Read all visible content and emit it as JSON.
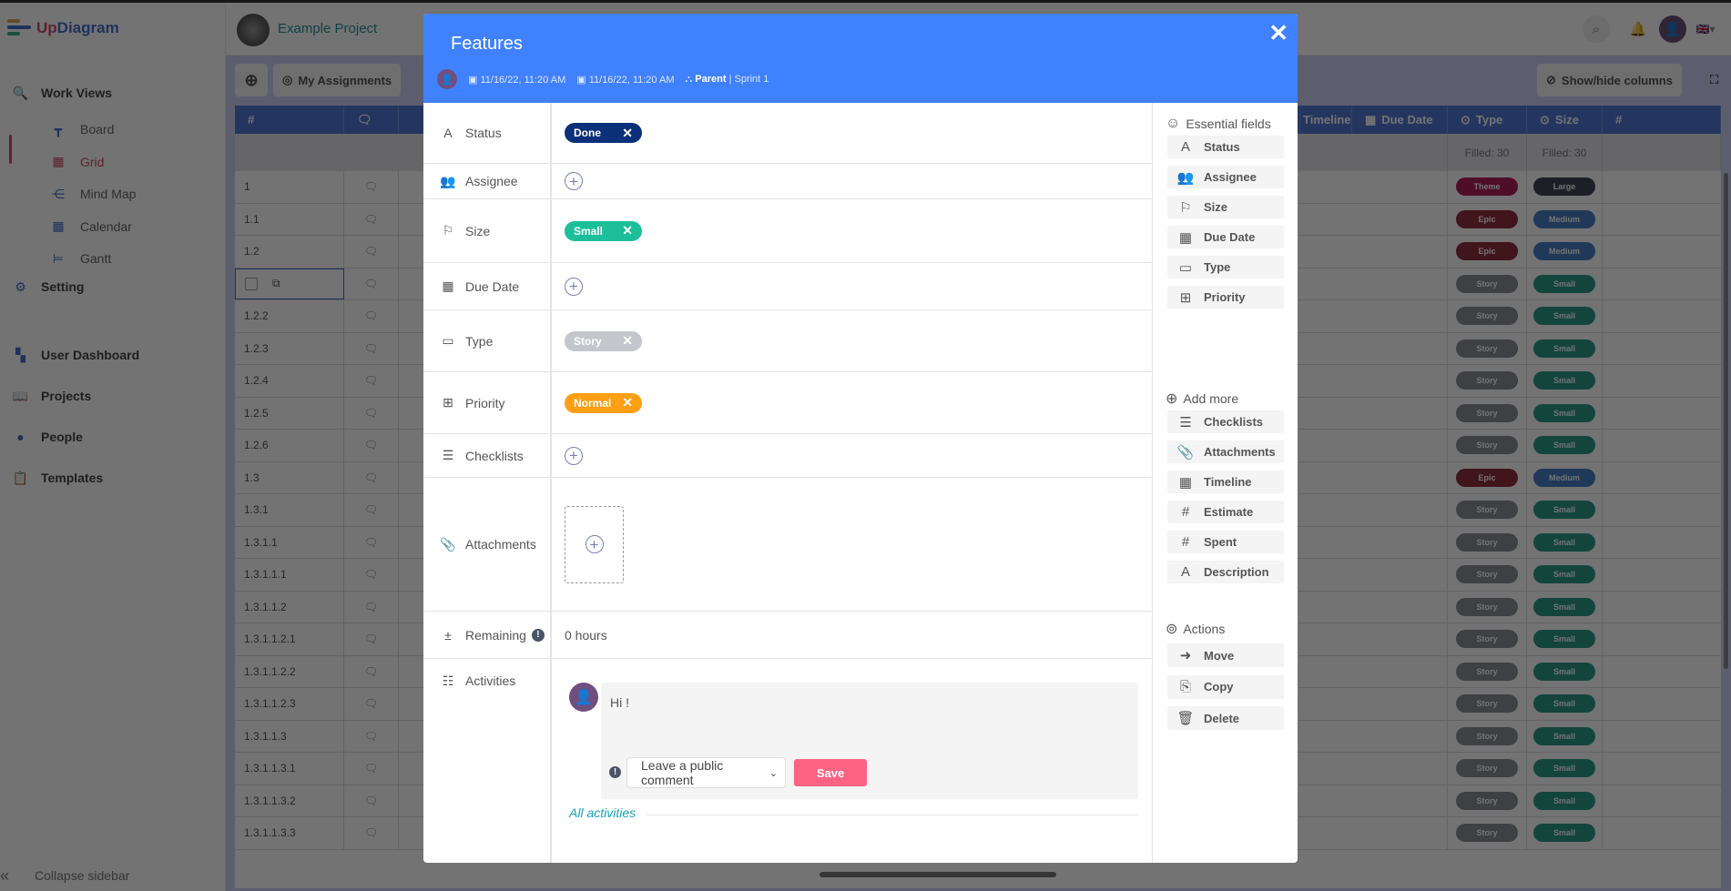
{
  "app": {
    "logo_text_a": "Up",
    "logo_text_b": "Diagram",
    "project_name": "Example Project"
  },
  "sidebar": {
    "work_views": "Work Views",
    "views": [
      {
        "label": "Board",
        "icon": "board-icon"
      },
      {
        "label": "Grid",
        "icon": "grid-icon",
        "active": true
      },
      {
        "label": "Mind Map",
        "icon": "mind-map-icon"
      },
      {
        "label": "Calendar",
        "icon": "calendar-icon"
      },
      {
        "label": "Gantt",
        "icon": "gantt-icon"
      }
    ],
    "setting": "Setting",
    "items": [
      {
        "label": "User Dashboard",
        "icon": "dashboard-icon"
      },
      {
        "label": "Projects",
        "icon": "book-icon"
      },
      {
        "label": "People",
        "icon": "person-icon"
      },
      {
        "label": "Templates",
        "icon": "clipboard-icon"
      }
    ],
    "collapse": "Collapse sidebar"
  },
  "toolbar": {
    "my_assignments": "My Assignments",
    "show_hide": "Show/hide columns"
  },
  "grid": {
    "headers": {
      "id": "#",
      "timeline": "Timeline",
      "due_date": "Due Date",
      "type": "Type",
      "size": "Size",
      "more": "#"
    },
    "filled_type": "Filled: 30",
    "filled_size": "Filled: 30",
    "rows": [
      {
        "id": "1",
        "type": "Theme",
        "size": "Large"
      },
      {
        "id": "1.1",
        "type": "Epic",
        "size": "Medium"
      },
      {
        "id": "1.2",
        "type": "Epic",
        "size": "Medium"
      },
      {
        "id": "",
        "type": "Story",
        "size": "Small",
        "selected": true
      },
      {
        "id": "1.2.2",
        "type": "Story",
        "size": "Small"
      },
      {
        "id": "1.2.3",
        "type": "Story",
        "size": "Small"
      },
      {
        "id": "1.2.4",
        "type": "Story",
        "size": "Small"
      },
      {
        "id": "1.2.5",
        "type": "Story",
        "size": "Small"
      },
      {
        "id": "1.2.6",
        "type": "Story",
        "size": "Small"
      },
      {
        "id": "1.3",
        "type": "Epic",
        "size": "Medium"
      },
      {
        "id": "1.3.1",
        "type": "Story",
        "size": "Small"
      },
      {
        "id": "1.3.1.1",
        "type": "Story",
        "size": "Small"
      },
      {
        "id": "1.3.1.1.1",
        "type": "Story",
        "size": "Small"
      },
      {
        "id": "1.3.1.1.2",
        "type": "Story",
        "size": "Small"
      },
      {
        "id": "1.3.1.1.2.1",
        "type": "Story",
        "size": "Small"
      },
      {
        "id": "1.3.1.1.2.2",
        "type": "Story",
        "size": "Small"
      },
      {
        "id": "1.3.1.1.2.3",
        "type": "Story",
        "size": "Small"
      },
      {
        "id": "1.3.1.1.3",
        "type": "Story",
        "size": "Small"
      },
      {
        "id": "1.3.1.1.3.1",
        "type": "Story",
        "size": "Small"
      },
      {
        "id": "1.3.1.1.3.2",
        "type": "Story",
        "size": "Small"
      },
      {
        "id": "1.3.1.1.3.3",
        "type": "Story",
        "size": "Small"
      }
    ],
    "colors": {
      "Theme": "#c2185b",
      "Epic": "#9c2b3a",
      "Story": "#8a8f99",
      "Large": "#3d4457",
      "Medium": "#3f7fd0",
      "Small": "#1d9e8a"
    }
  },
  "modal": {
    "title": "Features",
    "created": "11/16/22, 11:20 AM",
    "updated": "11/16/22, 11:20 AM",
    "parent": "Parent",
    "sprint": "| Sprint 1",
    "fields": {
      "status": {
        "label": "Status",
        "value": "Done",
        "color": "#0b2f78"
      },
      "assignee": {
        "label": "Assignee"
      },
      "size": {
        "label": "Size",
        "value": "Small",
        "color": "#1dbf9b"
      },
      "due_date": {
        "label": "Due Date"
      },
      "type": {
        "label": "Type",
        "value": "Story",
        "color": "#c3c6ca"
      },
      "priority": {
        "label": "Priority",
        "value": "Normal",
        "color": "#ff9f14"
      },
      "checklists": {
        "label": "Checklists"
      },
      "attachments": {
        "label": "Attachments"
      },
      "remaining": {
        "label": "Remaining",
        "value": "0 hours"
      },
      "activities": {
        "label": "Activities"
      }
    },
    "comment": {
      "text": "Hi !",
      "visibility": "Leave a public comment",
      "save": "Save"
    },
    "all_activities": "All activities",
    "panel": {
      "essential_title": "Essential fields",
      "essential": [
        "Status",
        "Assignee",
        "Size",
        "Due Date",
        "Type",
        "Priority"
      ],
      "add_more_title": "Add more",
      "add_more": [
        "Checklists",
        "Attachments",
        "Timeline",
        "Estimate",
        "Spent",
        "Description"
      ],
      "actions_title": "Actions",
      "actions": [
        "Move",
        "Copy",
        "Delete"
      ]
    }
  }
}
